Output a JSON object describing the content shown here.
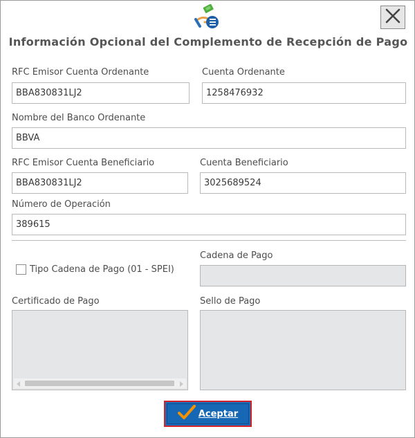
{
  "dialog": {
    "title": "Información Opcional del Complemento de Recepción de Pago"
  },
  "icons": {
    "header": "payment-document-icon",
    "close": "close-icon",
    "accept": "checkmark-icon"
  },
  "fields": {
    "rfc_emisor_ordenante": {
      "label": "RFC Emisor Cuenta Ordenante",
      "value": "BBA830831LJ2"
    },
    "cuenta_ordenante": {
      "label": "Cuenta Ordenante",
      "value": "1258476932"
    },
    "nombre_banco_ordenante": {
      "label": "Nombre del Banco Ordenante",
      "value": "BBVA"
    },
    "rfc_emisor_beneficiario": {
      "label": "RFC Emisor Cuenta Beneficiario",
      "value": "BBA830831LJ2"
    },
    "cuenta_beneficiario": {
      "label": "Cuenta Beneficiario",
      "value": "3025689524"
    },
    "numero_operacion": {
      "label": "Número de Operación",
      "value": "389615"
    },
    "tipo_cadena_pago": {
      "label": "Tipo Cadena de Pago (01 - SPEI)",
      "checked": false
    },
    "cadena_pago": {
      "label": "Cadena de Pago",
      "value": ""
    },
    "certificado_pago": {
      "label": "Certificado de Pago",
      "value": ""
    },
    "sello_pago": {
      "label": "Sello de Pago",
      "value": ""
    }
  },
  "buttons": {
    "accept_label": "Aceptar"
  },
  "colors": {
    "accept_bg": "#1668b4",
    "accept_border": "#d2232a",
    "check_orange": "#f39200",
    "disabled_bg": "#e4e6e8"
  }
}
